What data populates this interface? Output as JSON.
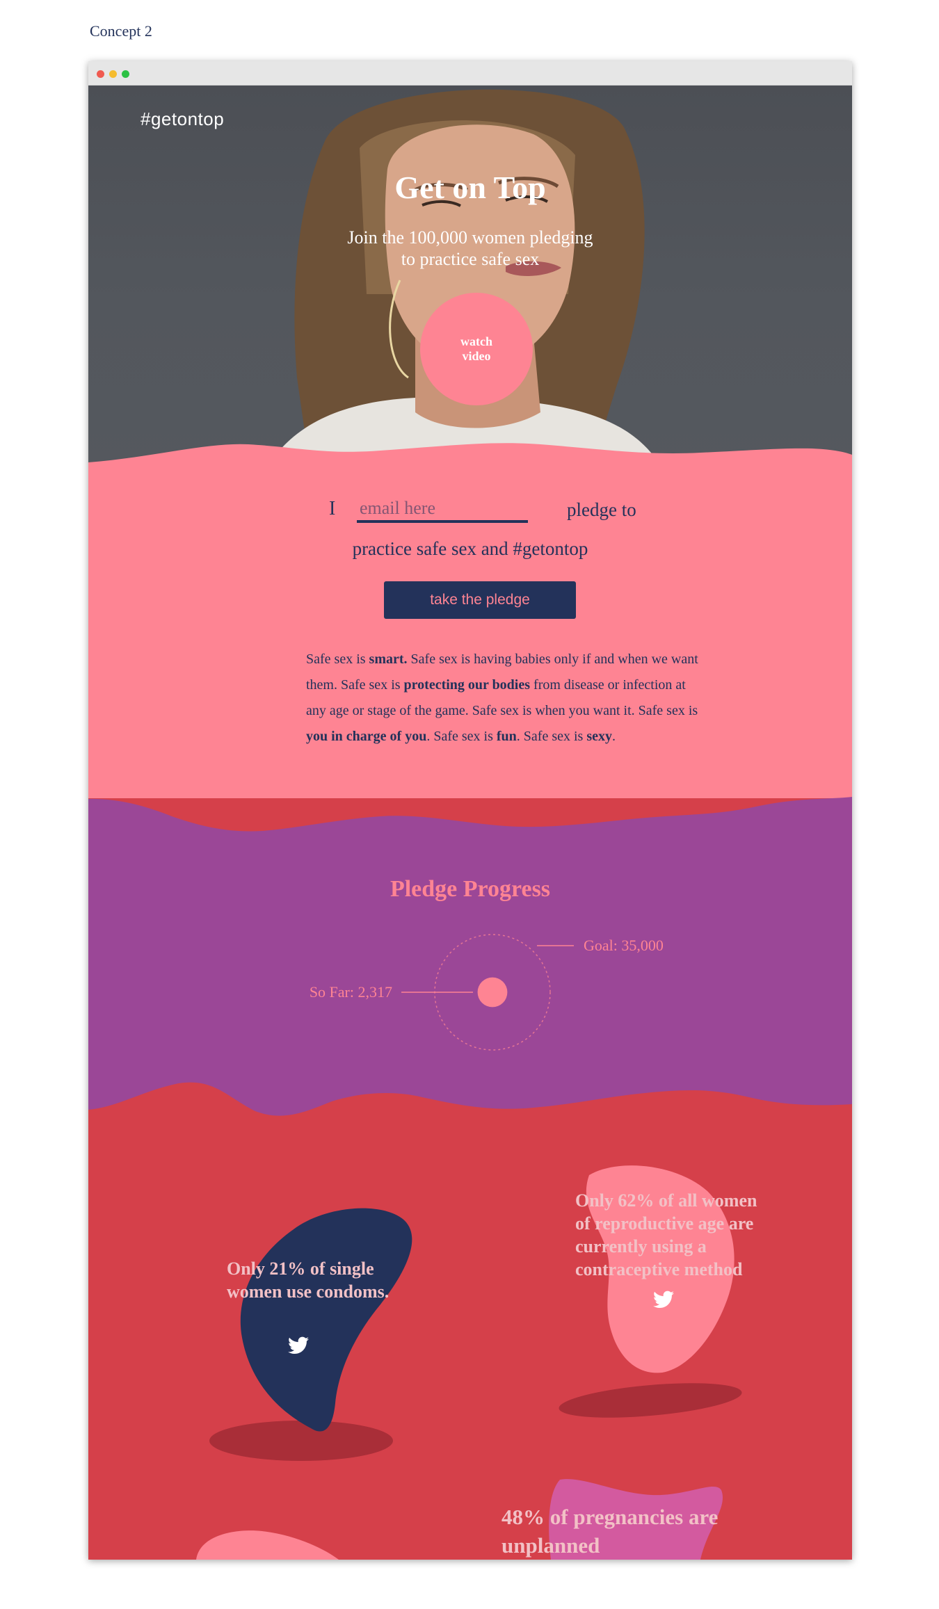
{
  "concept_label": "Concept 2",
  "hero": {
    "hashtag": "#getontop",
    "title": "Get on Top",
    "subtitle_line1": "Join the 100,000 women pledging",
    "subtitle_line2": "to practice safe sex",
    "watch_line1": "watch",
    "watch_line2": "video"
  },
  "pledge": {
    "prefix": "I",
    "email_placeholder": "email here",
    "suffix": "pledge to",
    "line2": "practice safe sex and #getontop",
    "button_label": "take the pledge"
  },
  "manifesto": {
    "p1": "Safe sex is ",
    "b1": "smart.",
    "p2": " Safe sex is having babies only if and when we want them. Safe sex is ",
    "b2": "protecting our bodies",
    "p3": " from disease or infection at any age or stage of the game. Safe sex is when you want it. Safe sex is ",
    "b3": "you in charge of you",
    "p4": ". Safe sex is ",
    "b4": "fun",
    "p5": ". Safe sex is ",
    "b5": "sexy",
    "p6": "."
  },
  "progress": {
    "title": "Pledge Progress",
    "so_far_label": "So Far: 2,317",
    "goal_label": "Goal: 35,000",
    "so_far": 2317,
    "goal": 35000
  },
  "stats": {
    "stat1_line1": "Only 21% of single",
    "stat1_line2": "women use condoms.",
    "stat2_line1": "Only 62% of all women",
    "stat2_line2": "of reproductive age are",
    "stat2_line3": "currently using a",
    "stat2_line4": "contraceptive method",
    "stat3_line1": "48% of pregnancies are",
    "stat3_line2": "unplanned"
  },
  "colors": {
    "pink": "#fe8493",
    "purple": "#9b4797",
    "red": "#d5404a",
    "navy": "#23325a"
  }
}
